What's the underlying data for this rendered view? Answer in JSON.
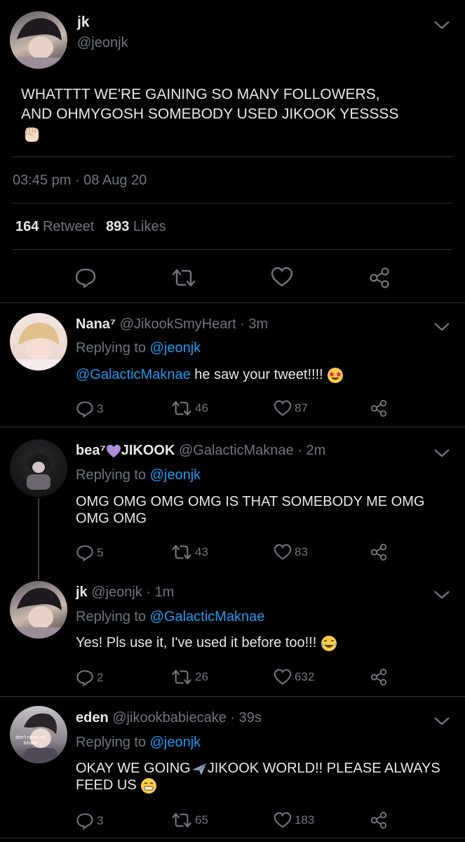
{
  "main_tweet": {
    "name": "jk",
    "handle": "@jeonjk",
    "text_line1": "WHATTTT WE'RE GAINING SO MANY FOLLOWERS,",
    "text_line2": "AND OHMYGOSH SOMEBODY USED JIKOOK YESSSS",
    "emoji": "raised-fist",
    "time": "03:45 pm",
    "date": "08 Aug 20",
    "retweets": "164",
    "retweets_label": "Retweet",
    "likes": "893",
    "likes_label": "Likes"
  },
  "replies": [
    {
      "name": "Nana⁷",
      "handle": "@JikookSmyHeart",
      "ago": "3m",
      "replying_label": "Replying to",
      "replying_to": "@jeonjk",
      "mention": "@GalacticMaknae",
      "text": "he saw your tweet!!!!",
      "emoji": "star-struck",
      "replies": "3",
      "retweets": "46",
      "likes": "87"
    },
    {
      "name": "bea⁷",
      "name_suffix": "JIKOOK",
      "handle": "@GalacticMaknae",
      "ago": "2m",
      "replying_label": "Replying to",
      "replying_to": "@jeonjk",
      "text_line1": "OMG OMG OMG OMG IS THAT SOMEBODY ME OMG",
      "text_line2": "OMG OMG",
      "replies": "5",
      "retweets": "43",
      "likes": "83"
    },
    {
      "name": "jk",
      "handle": "@jeonjk",
      "ago": "1m",
      "replying_label": "Replying to",
      "replying_to": "@GalacticMaknae",
      "text": "Yes! Pls use it, I've used it before too!!!",
      "emoji": "tears-of-joy",
      "replies": "2",
      "retweets": "26",
      "likes": "632"
    },
    {
      "name": "eden",
      "handle": "@jikookbabiecake",
      "ago": "39s",
      "replying_label": "Replying to",
      "replying_to": "@jeonjk",
      "text_line1a": "OKAY WE GOING",
      "text_line1b": "JIKOOK WORLD!! PLEASE ALWAYS",
      "text_line2": "FEED US",
      "avatar_caption": "don't need my inhaler",
      "replies": "3",
      "retweets": "65",
      "likes": "183"
    }
  ],
  "colors": {
    "background": "#000000",
    "text": "#e8e8e8",
    "muted": "#6e767d",
    "link": "#1d9bf0",
    "divider": "#2f3336"
  }
}
